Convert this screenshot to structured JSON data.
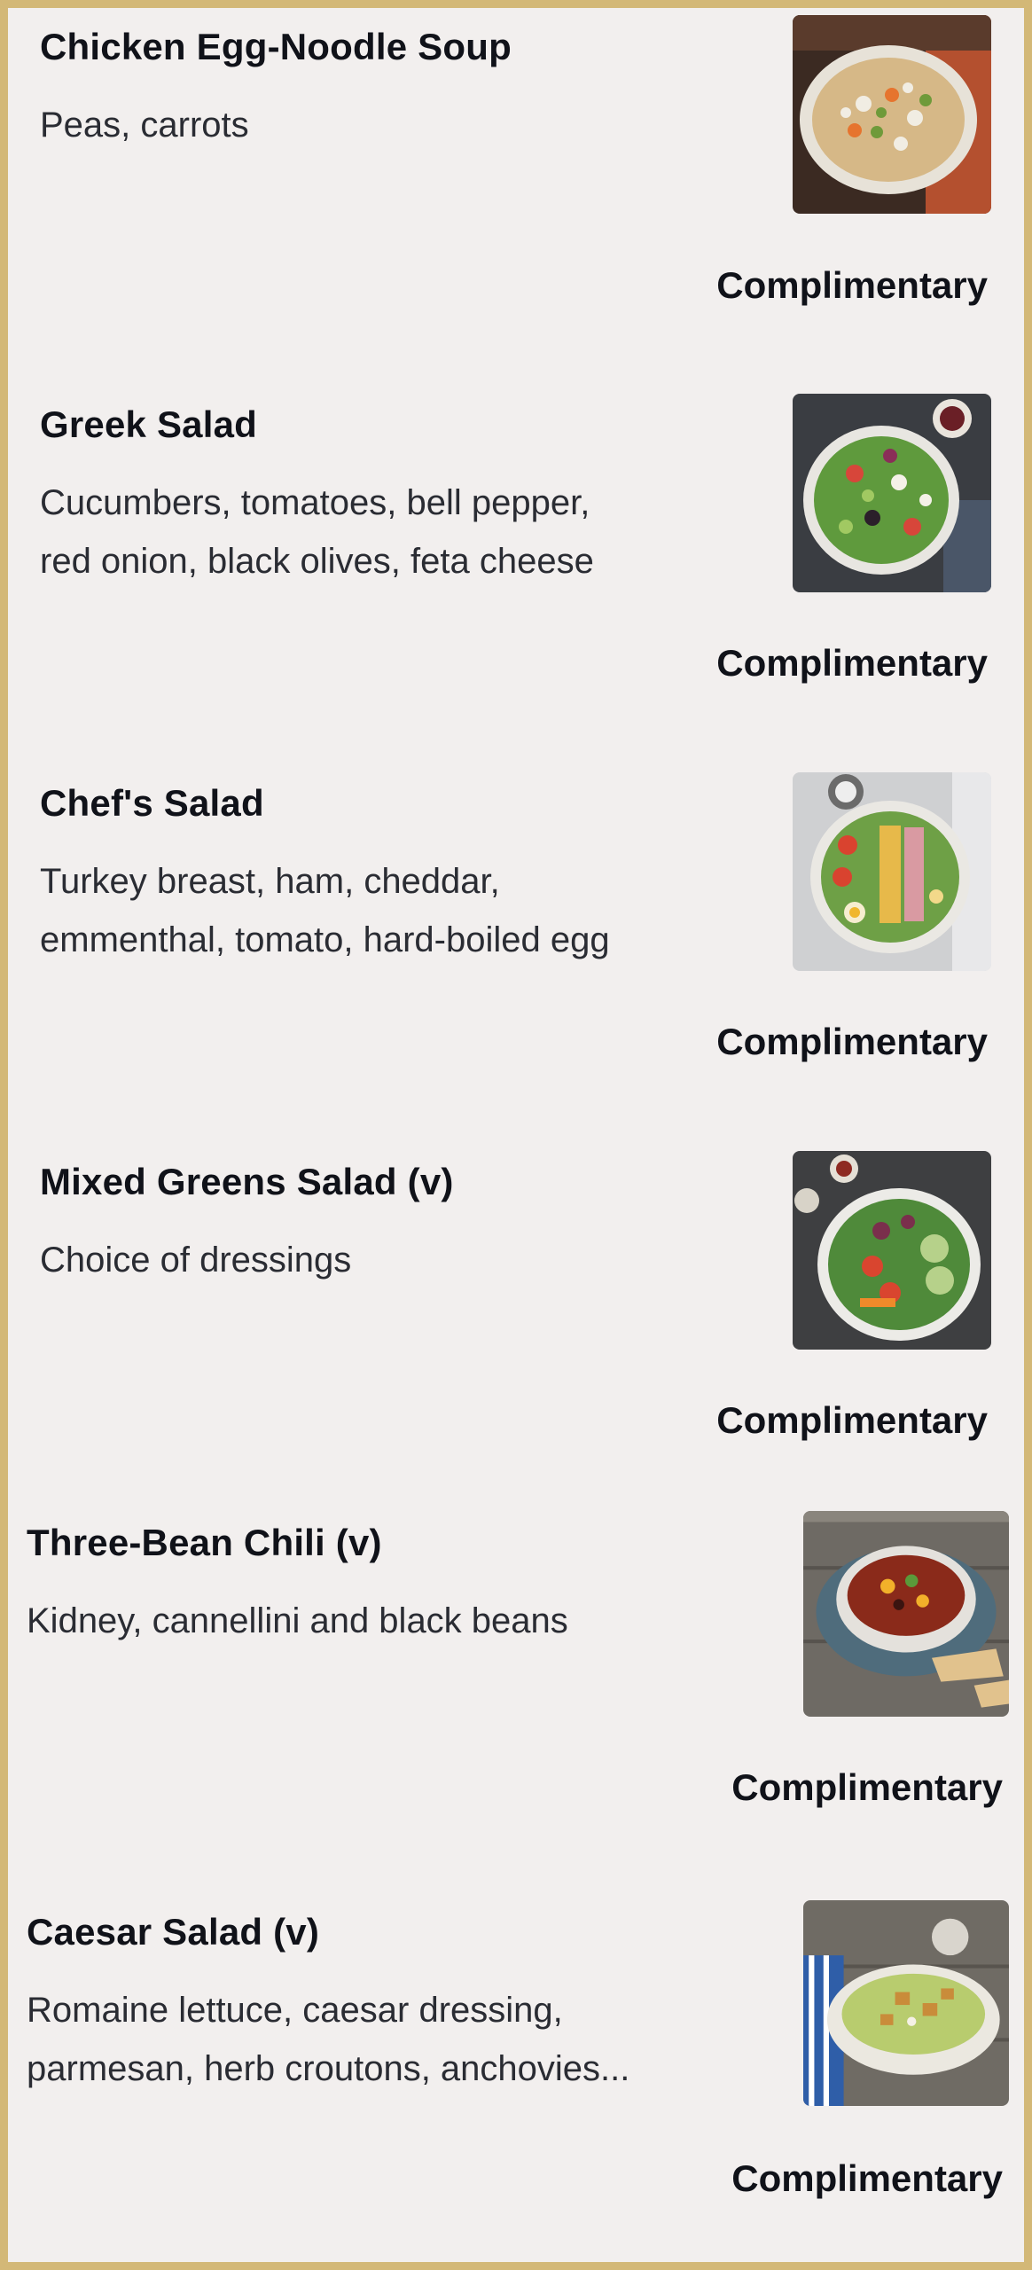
{
  "menu": {
    "items": [
      {
        "title": "Chicken Egg-Noodle Soup",
        "description_lines": [
          "Peas, carrots"
        ],
        "price": "Complimentary",
        "photo": "chicken-egg-noodle-soup-photo"
      },
      {
        "title": "Greek Salad",
        "description_lines": [
          "Cucumbers, tomatoes, bell pepper,",
          "red onion, black olives, feta cheese"
        ],
        "price": "Complimentary",
        "photo": "greek-salad-photo"
      },
      {
        "title": "Chef's Salad",
        "description_lines": [
          "Turkey breast, ham, cheddar,",
          "emmenthal, tomato, hard-boiled egg"
        ],
        "price": "Complimentary",
        "photo": "chefs-salad-photo"
      },
      {
        "title": "Mixed Greens Salad (v)",
        "description_lines": [
          "Choice of dressings"
        ],
        "price": "Complimentary",
        "photo": "mixed-greens-salad-photo"
      },
      {
        "title": "Three-Bean Chili (v)",
        "description_lines": [
          "Kidney, cannellini and black beans"
        ],
        "price": "Complimentary",
        "photo": "three-bean-chili-photo"
      },
      {
        "title": "Caesar Salad (v)",
        "description_lines": [
          "Romaine lettuce, caesar dressing,",
          "parmesan, herb croutons, anchovies..."
        ],
        "price": "Complimentary",
        "photo": "caesar-salad-photo"
      }
    ]
  },
  "colors": {
    "frame_border": "#d3b877",
    "background": "#f2efee",
    "title_text": "#101219",
    "body_text": "#2a2c33"
  }
}
